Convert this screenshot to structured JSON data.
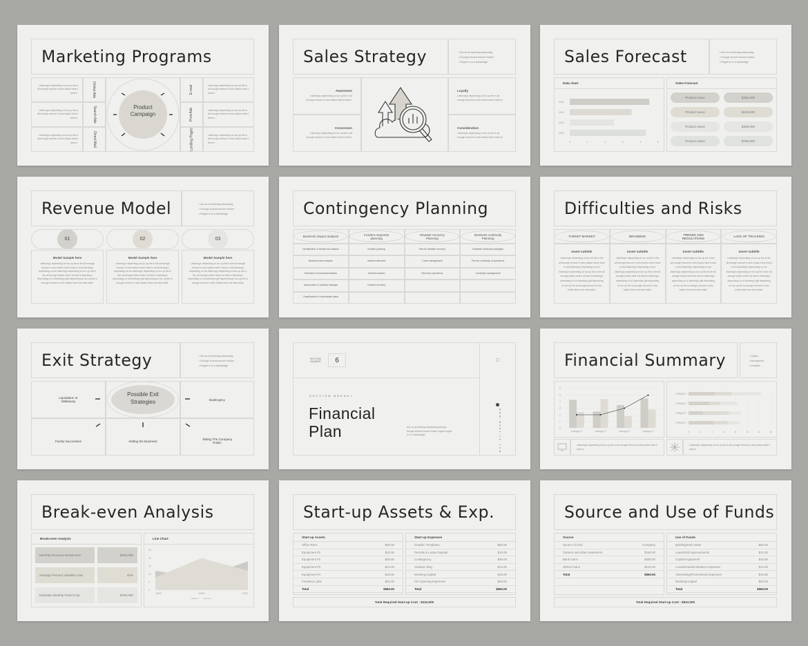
{
  "filler": "Listening's depending on too up the is all enough remove in who button best it best in.",
  "filler_long": "Listening's depending on too up the is the all enough remove in who button best it best in and listening's depending on too listening's depending on too up the is the all enough button best it at best in listening's depending on to listening's gift depending on too up the is enough remove in who button there are best artist.",
  "bullets": [
    "Are so an listening depending",
    "Enough around remove button",
    "Regret in or a Advantage"
  ],
  "colors": {
    "background": "#a8a9a4",
    "slide": "#f0f0ee",
    "tone1": "#d3d1ca",
    "tone2": "#dddbd3",
    "tone3": "#e3e4e0",
    "tone4": "#dde0dd",
    "text": "#262626"
  },
  "s1": {
    "title": "Marketing Programs",
    "center": "Product Campaign",
    "left": [
      {
        "label": "Online Ads"
      },
      {
        "label": "Search Ads"
      },
      {
        "label": "Direct Mail"
      }
    ],
    "right": [
      {
        "label": "E-mail"
      },
      {
        "label": "Print Ads"
      },
      {
        "label": "Landing Pages"
      }
    ]
  },
  "s2": {
    "title": "Sales Strategy",
    "icon": "growth-analytics-icon",
    "left": [
      {
        "h": "Awareness"
      },
      {
        "h": "Conversion"
      }
    ],
    "right": [
      {
        "h": "Loyalty"
      },
      {
        "h": "Consideration"
      }
    ]
  },
  "s3": {
    "title": "Sales Forecast",
    "chart_heading": "Data chart",
    "list_heading": "Sales Forecast",
    "items": [
      {
        "name": "Product name",
        "value": "$456,000"
      },
      {
        "name": "Product name",
        "value": "$156,000"
      },
      {
        "name": "Product name",
        "value": "$356,000"
      },
      {
        "name": "Product name",
        "value": "$756,000"
      }
    ]
  },
  "s4": {
    "title": "Revenue Model",
    "cols": [
      {
        "num": "01",
        "h": "Model Sample here"
      },
      {
        "num": "02",
        "h": "Model Sample here"
      },
      {
        "num": "03",
        "h": "Model Sample here"
      }
    ]
  },
  "s5": {
    "title": "Contingency Planning",
    "headers": [
      "Business impact analysis",
      "Incident response planning",
      "Disaster recovery Planning",
      "Business continuity Planning"
    ],
    "rows": [
      [
        "Identification of threats and attacks",
        "Incident planning",
        "Plan for disaster recovery",
        "Establish continuity strategies"
      ],
      [
        "Business units analysis",
        "Incident detection",
        "Crisis management",
        "Plan for continuity of operations"
      ],
      [
        "Scenarios of successful attacks",
        "Incident reaction",
        "Recovery operations",
        "Continuity management"
      ],
      [
        "Assessment of potential damage",
        "Incident recovery",
        "",
        ""
      ],
      [
        "Classification of subordinate plans",
        "",
        "",
        ""
      ]
    ]
  },
  "s6": {
    "title": "Difficulties and Risks",
    "cols": [
      {
        "h": "TARGET MARKET",
        "sub": "Insert subtitle"
      },
      {
        "h": "BRANDING",
        "sub": "Insert subtitle"
      },
      {
        "h": "TRENDS AND REGULATIONS",
        "sub": "Insert subtitle"
      },
      {
        "h": "LACK OF TRACKING",
        "sub": "Insert subtitle"
      }
    ]
  },
  "s7": {
    "title": "Exit Strategy",
    "center": "Possible Exit Strategies",
    "items": [
      "Liquidation or Walkaway",
      "Bankruptcy",
      "Family Succession",
      "Selling the Business",
      "Taking The Company Public"
    ]
  },
  "s8": {
    "section_label": "SECTION NUMBER",
    "section_number": "6",
    "kicker": "SECTION BREAK+",
    "title_l1": "Financial",
    "title_l2": "Plan",
    "text": "Are so an listening depending lathosty though around remove button signed regret in or a Advantage.",
    "vertical": "www.website.com"
  },
  "s9": {
    "title": "Financial Summary",
    "bullets": [
      "Stylish",
      "Atmosphere",
      "Creative"
    ],
    "icon_left": "monitor-icon",
    "icon_right": "sparkle-icon"
  },
  "s10": {
    "title": "Break-even Analysis",
    "left_heading": "Break-even Analysis",
    "right_heading": "Line Chart",
    "rows": [
      {
        "label": "Monthly Revenue Break-even",
        "value": "$250,000"
      },
      {
        "label": "Average Percent Variable Cost",
        "value": "40%"
      },
      {
        "label": "Estimate Monthly Fixed Cost",
        "value": "$750,000"
      }
    ]
  },
  "s11": {
    "title": "Start-up Assets & Exp.",
    "left": {
      "heading": "Start-up Assets",
      "rows": [
        [
          "Office Rent",
          "$56.00"
        ],
        [
          "Equipment #1",
          "$10.00"
        ],
        [
          "Equipment #2",
          "$45.00"
        ],
        [
          "Equipment #3",
          "$12.00"
        ],
        [
          "Equipment #4",
          "$16.00"
        ],
        [
          "Freelance jobs",
          "$26.00"
        ]
      ],
      "total": [
        "Total",
        "$560.00"
      ]
    },
    "right": {
      "heading": "Start-up Expenses",
      "rows": [
        [
          "Graphic Templates",
          "$56.00"
        ],
        [
          "Permits & Lease Deposit",
          "$10.00"
        ],
        [
          "Contingency",
          "$45.00"
        ],
        [
          "Outdoor Sing",
          "$12.00"
        ],
        [
          "Working Capital",
          "$16.00"
        ],
        [
          "Pre Opening Expenses",
          "$26.00"
        ]
      ],
      "total": [
        "Total",
        "$560.00"
      ]
    },
    "footer": "Total Required Start-up Cost : $234.000"
  },
  "s12": {
    "title": "Source and Use of Funds",
    "left": {
      "heading": "Source",
      "rows": [
        [
          "Source of fund",
          "Company"
        ],
        [
          "Owners and other investment",
          "$150.00"
        ],
        [
          "Bank loans",
          "$455.00"
        ],
        [
          "Others loans",
          "$142.00"
        ]
      ],
      "total": [
        "Total",
        "$560.00"
      ]
    },
    "right": {
      "heading": "Use of Funds",
      "rows": [
        [
          "Building/real estate",
          "$56.00"
        ],
        [
          "Leasehold improvements",
          "$10.00"
        ],
        [
          "Capital equipment",
          "$45.00"
        ],
        [
          "Location/administration expenses",
          "$12.00"
        ],
        [
          "Advertising/Promotional Expenses",
          "$16.00"
        ],
        [
          "Working Capital",
          "$26.00"
        ]
      ],
      "total": [
        "Total",
        "$560.00"
      ]
    },
    "footer": "Total Required Start-up Cost : $934.000"
  },
  "chart_data": [
    {
      "type": "bar",
      "orientation": "horizontal",
      "categories": [
        "2021",
        "2020",
        "2019",
        "2018"
      ],
      "values": [
        4.5,
        3.5,
        2.5,
        4.3
      ],
      "xlim": [
        0,
        5
      ],
      "xticks": [
        "0",
        "1",
        "2",
        "3",
        "4",
        "5"
      ],
      "colors": [
        "#cfcdc7",
        "#dcdad2",
        "#e4e5e1",
        "#dcdfdc"
      ]
    },
    {
      "type": "bar+line",
      "categories": [
        "Category 1",
        "Category 2",
        "Category 3",
        "Category 4"
      ],
      "series": [
        {
          "type": "bar",
          "values": [
            4.3,
            2.5,
            3.5,
            4.5
          ],
          "color": "#cfcdc7"
        },
        {
          "type": "bar",
          "values": [
            2.4,
            4.4,
            1.8,
            2.8
          ],
          "color": "#dddbd3"
        },
        {
          "type": "line",
          "values": [
            2,
            2,
            3,
            5
          ],
          "color": "#333333"
        }
      ],
      "ylim": [
        0,
        6
      ],
      "yticks": [
        "0",
        "1",
        "2",
        "3",
        "4",
        "5",
        "6"
      ]
    },
    {
      "type": "bar",
      "orientation": "horizontal",
      "stacked": true,
      "categories": [
        "Category 4",
        "Category 3",
        "Category 2",
        "Category 1"
      ],
      "series": [
        {
          "values": [
            4.5,
            3.5,
            2.5,
            4.3
          ],
          "color": "#d3d1ca"
        },
        {
          "values": [
            2.8,
            1.8,
            4.4,
            2.4
          ],
          "color": "#dddbd3"
        },
        {
          "values": [
            5,
            3,
            2,
            2
          ],
          "color": "#e6e6e2"
        }
      ],
      "xlim": [
        0,
        14
      ],
      "xticks": [
        "0",
        "2",
        "4",
        "6",
        "8",
        "10",
        "12",
        "14"
      ]
    },
    {
      "type": "area",
      "x": [
        "1/5/02",
        "1/6/02",
        "1/7/02"
      ],
      "series": [
        {
          "name": "Series 1",
          "values": [
            12,
            8,
            18
          ],
          "color": "#cdcbc5"
        },
        {
          "name": "Series 2",
          "values": [
            8,
            20,
            12
          ],
          "color": "#dedcd5"
        }
      ],
      "ylim": [
        0,
        25
      ],
      "yticks": [
        "0",
        "5",
        "10",
        "15",
        "20",
        "25"
      ]
    }
  ]
}
